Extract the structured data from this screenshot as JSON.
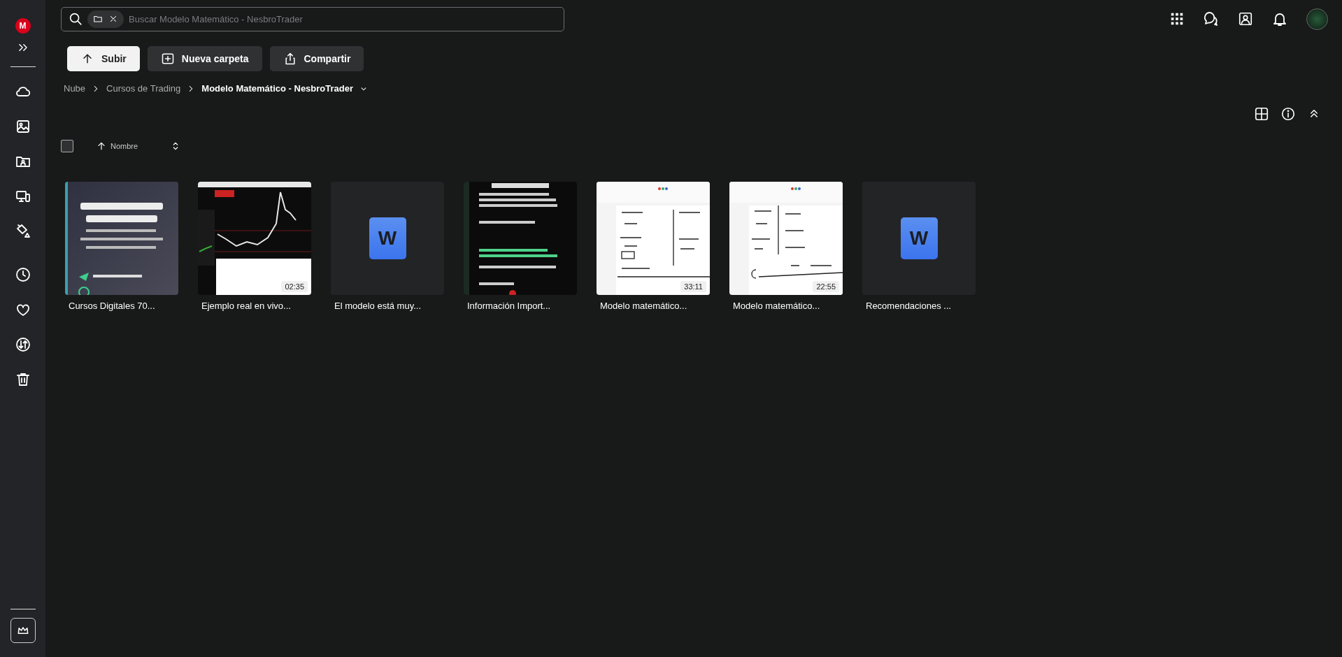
{
  "sidebar": {
    "logo": "M"
  },
  "search": {
    "placeholder": "Buscar Modelo Matemático - NesbroTrader"
  },
  "actions": [
    {
      "label": "Subir",
      "primary": true
    },
    {
      "label": "Nueva carpeta",
      "primary": false
    },
    {
      "label": "Compartir",
      "primary": false
    }
  ],
  "breadcrumb": [
    {
      "label": "Nube",
      "current": false
    },
    {
      "label": "Cursos de Trading",
      "current": false
    },
    {
      "label": "Modelo Matemático - NesbroTrader",
      "current": true
    }
  ],
  "sort": {
    "checked": false,
    "label": "Nombre"
  },
  "files": [
    {
      "name": "Cursos Digitales 70...",
      "kind": "picture"
    },
    {
      "name": "Ejemplo real en vivo...",
      "kind": "video",
      "duration": "02:35"
    },
    {
      "name": "El modelo está muy...",
      "kind": "document",
      "badge": "W"
    },
    {
      "name": "Información Import...",
      "kind": "picture"
    },
    {
      "name": "Modelo matemático...",
      "kind": "video",
      "duration": "33:11"
    },
    {
      "name": "Modelo matemático...",
      "kind": "video",
      "duration": "22:55"
    },
    {
      "name": "Recomendaciones ...",
      "kind": "document",
      "badge": "W"
    }
  ]
}
